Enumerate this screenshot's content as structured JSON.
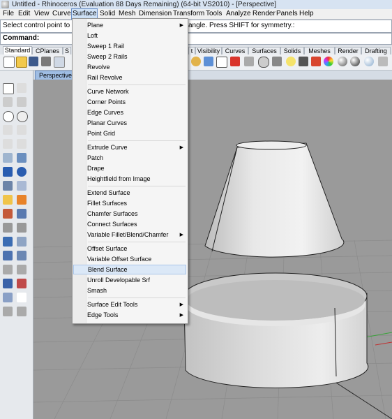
{
  "title_bar": {
    "text": "Untitled - Rhinoceros (Evaluation 88 Days Remaining) (64-bit VS2010) - [Perspective]"
  },
  "menubar": [
    {
      "key": "file",
      "label": "File"
    },
    {
      "key": "edit",
      "label": "Edit"
    },
    {
      "key": "view",
      "label": "View"
    },
    {
      "key": "curve",
      "label": "Curve"
    },
    {
      "key": "surface",
      "label": "Surface"
    },
    {
      "key": "solid",
      "label": "Solid"
    },
    {
      "key": "mesh",
      "label": "Mesh"
    },
    {
      "key": "dimension",
      "label": "Dimension"
    },
    {
      "key": "transform",
      "label": "Transform"
    },
    {
      "key": "tools",
      "label": "Tools"
    },
    {
      "key": "analyze",
      "label": "Analyze"
    },
    {
      "key": "render",
      "label": "Render"
    },
    {
      "key": "panels",
      "label": "Panels"
    },
    {
      "key": "help",
      "label": "Help"
    }
  ],
  "command_history": {
    "left": "Select control point to adju",
    "right": "angle. Press SHIFT for symmetry.:"
  },
  "command_line": {
    "label": "Command:"
  },
  "toolbar_tabs": [
    {
      "key": "standard",
      "label": "Standard",
      "active": true
    },
    {
      "key": "cplanes",
      "label": "CPlanes"
    },
    {
      "key": "s",
      "label": "S"
    },
    {
      "key": "t",
      "label": "t"
    },
    {
      "key": "visibility",
      "label": "Visibility"
    },
    {
      "key": "curves",
      "label": "Curves"
    },
    {
      "key": "surfaces",
      "label": "Surfaces"
    },
    {
      "key": "solids",
      "label": "Solids"
    },
    {
      "key": "meshes",
      "label": "Meshes"
    },
    {
      "key": "render",
      "label": "Render"
    },
    {
      "key": "drafting",
      "label": "Drafting"
    }
  ],
  "viewport": {
    "label": "Perspective"
  },
  "surface_menu": {
    "items": [
      {
        "label": "Plane",
        "submenu": true
      },
      {
        "label": "Loft"
      },
      {
        "label": "Sweep 1 Rail"
      },
      {
        "label": "Sweep 2 Rails"
      },
      {
        "label": "Revolve"
      },
      {
        "label": "Rail Revolve"
      },
      {
        "sep": true
      },
      {
        "label": "Curve Network"
      },
      {
        "label": "Corner Points"
      },
      {
        "label": "Edge Curves"
      },
      {
        "label": "Planar Curves"
      },
      {
        "label": "Point Grid"
      },
      {
        "sep": true
      },
      {
        "label": "Extrude Curve",
        "submenu": true
      },
      {
        "label": "Patch"
      },
      {
        "label": "Drape"
      },
      {
        "label": "Heightfield from Image"
      },
      {
        "sep": true
      },
      {
        "label": "Extend Surface"
      },
      {
        "label": "Fillet Surfaces"
      },
      {
        "label": "Chamfer Surfaces"
      },
      {
        "label": "Connect Surfaces"
      },
      {
        "label": "Variable Fillet/Blend/Chamfer",
        "submenu": true
      },
      {
        "sep": true
      },
      {
        "label": "Offset Surface"
      },
      {
        "label": "Variable Offset Surface"
      },
      {
        "label": "Blend Surface",
        "highlighted": true
      },
      {
        "label": "Unroll Developable Srf"
      },
      {
        "label": "Smash"
      },
      {
        "sep": true
      },
      {
        "label": "Surface Edit Tools",
        "submenu": true
      },
      {
        "label": "Edge Tools",
        "submenu": true
      }
    ]
  },
  "colors": {
    "viewport_bg": "#9a9a9a",
    "grid_line": "#8a8a8a",
    "menu_highlight": "#dbe8f7",
    "axis_red": "#c03030",
    "axis_green": "#30a030"
  }
}
